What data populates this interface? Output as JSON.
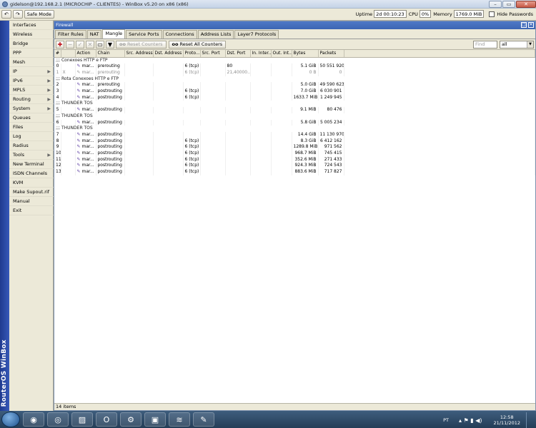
{
  "window": {
    "title": "gidelson@192.168.2.1 (MICROCHIP - CLIENTES) - WinBox v5.20 on x86 (x86)"
  },
  "toolbar": {
    "safe_mode": "Safe Mode",
    "uptime_label": "Uptime",
    "uptime": "2d 00:10:23",
    "cpu_label": "CPU",
    "cpu": "0%",
    "memory_label": "Memory",
    "memory": "1769.0 MiB",
    "hide_passwords": "Hide Passwords"
  },
  "sidebar": {
    "brand": "RouterOS WinBox",
    "items": [
      {
        "label": "Interfaces",
        "submenu": false
      },
      {
        "label": "Wireless",
        "submenu": false
      },
      {
        "label": "Bridge",
        "submenu": false
      },
      {
        "label": "PPP",
        "submenu": false
      },
      {
        "label": "Mesh",
        "submenu": false
      },
      {
        "label": "IP",
        "submenu": true
      },
      {
        "label": "IPv6",
        "submenu": true
      },
      {
        "label": "MPLS",
        "submenu": true
      },
      {
        "label": "Routing",
        "submenu": true
      },
      {
        "label": "System",
        "submenu": true
      },
      {
        "label": "Queues",
        "submenu": false
      },
      {
        "label": "Files",
        "submenu": false
      },
      {
        "label": "Log",
        "submenu": false
      },
      {
        "label": "Radius",
        "submenu": false
      },
      {
        "label": "Tools",
        "submenu": true
      },
      {
        "label": "New Terminal",
        "submenu": false
      },
      {
        "label": "ISDN Channels",
        "submenu": false
      },
      {
        "label": "KVM",
        "submenu": false
      },
      {
        "label": "Make Supout.rif",
        "submenu": false
      },
      {
        "label": "Manual",
        "submenu": false
      },
      {
        "label": "Exit",
        "submenu": false
      }
    ]
  },
  "firewall": {
    "title": "Firewall",
    "tabs": [
      "Filter Rules",
      "NAT",
      "Mangle",
      "Service Ports",
      "Connections",
      "Address Lists",
      "Layer7 Protocols"
    ],
    "active_tab": "Mangle",
    "reset_counters": "Reset Counters",
    "reset_all_counters": "Reset All Counters",
    "find_placeholder": "Find",
    "filter_value": "all",
    "columns": [
      "#",
      "",
      "Action",
      "Chain",
      "Src. Address",
      "Dst. Address",
      "Proto...",
      "Src. Port",
      "Dst. Port",
      "In. Inter...",
      "Out. Int...",
      "Bytes",
      "Packets"
    ],
    "rows": [
      {
        "type": "comment",
        "text": ";;; Conexoes HTTP e FTP"
      },
      {
        "type": "rule",
        "num": "0",
        "flag": "",
        "action": "mar...",
        "chain": "prerouting",
        "proto": "6 (tcp)",
        "dst_port": "80",
        "bytes": "5.1 GiB",
        "packets": "50 551 920"
      },
      {
        "type": "rule",
        "disabled": true,
        "num": "1",
        "flag": "X",
        "action": "mar...",
        "chain": "prerouting",
        "proto": "6 (tcp)",
        "dst_port": "21,40000...",
        "bytes": "0 B",
        "packets": "0"
      },
      {
        "type": "comment",
        "text": ";;; Rota Conexoes HTTP e FTP"
      },
      {
        "type": "rule",
        "num": "2",
        "flag": "",
        "action": "mar...",
        "chain": "prerouting",
        "proto": "",
        "dst_port": "",
        "bytes": "5.0 GiB",
        "packets": "49 590 623"
      },
      {
        "type": "rule",
        "num": "3",
        "flag": "",
        "action": "mar...",
        "chain": "postrouting",
        "proto": "6 (tcp)",
        "dst_port": "",
        "bytes": "7.0 GiB",
        "packets": "6 030 901"
      },
      {
        "type": "rule",
        "num": "4",
        "flag": "",
        "action": "mar...",
        "chain": "postrouting",
        "proto": "6 (tcp)",
        "dst_port": "",
        "bytes": "1633.7 MiB",
        "packets": "1 249 945"
      },
      {
        "type": "comment",
        "text": ";;; THUNDER TOS"
      },
      {
        "type": "rule",
        "num": "5",
        "flag": "",
        "action": "mar...",
        "chain": "postrouting",
        "proto": "",
        "dst_port": "",
        "bytes": "9.1 MiB",
        "packets": "80 476"
      },
      {
        "type": "comment",
        "text": ";;; THUNDER TOS"
      },
      {
        "type": "rule",
        "num": "6",
        "flag": "",
        "action": "mar...",
        "chain": "postrouting",
        "proto": "",
        "dst_port": "",
        "bytes": "5.8 GiB",
        "packets": "5 005 234"
      },
      {
        "type": "comment",
        "text": ";;; THUNDER TOS"
      },
      {
        "type": "rule",
        "num": "7",
        "flag": "",
        "action": "mar...",
        "chain": "postrouting",
        "proto": "",
        "dst_port": "",
        "bytes": "14.4 GiB",
        "packets": "11 130 970"
      },
      {
        "type": "rule",
        "num": "8",
        "flag": "",
        "action": "mar...",
        "chain": "postrouting",
        "proto": "6 (tcp)",
        "dst_port": "",
        "bytes": "8.3 GiB",
        "packets": "6 412 162"
      },
      {
        "type": "rule",
        "num": "9",
        "flag": "",
        "action": "mar...",
        "chain": "postrouting",
        "proto": "6 (tcp)",
        "dst_port": "",
        "bytes": "1289.8 MiB",
        "packets": "971 562"
      },
      {
        "type": "rule",
        "num": "10",
        "flag": "",
        "action": "mar...",
        "chain": "postrouting",
        "proto": "6 (tcp)",
        "dst_port": "",
        "bytes": "968.7 MiB",
        "packets": "745 415"
      },
      {
        "type": "rule",
        "num": "11",
        "flag": "",
        "action": "mar...",
        "chain": "postrouting",
        "proto": "6 (tcp)",
        "dst_port": "",
        "bytes": "352.6 MiB",
        "packets": "271 433"
      },
      {
        "type": "rule",
        "num": "12",
        "flag": "",
        "action": "mar...",
        "chain": "postrouting",
        "proto": "6 (tcp)",
        "dst_port": "",
        "bytes": "924.3 MiB",
        "packets": "724 543"
      },
      {
        "type": "rule",
        "num": "13",
        "flag": "",
        "action": "mar...",
        "chain": "postrouting",
        "proto": "6 (tcp)",
        "dst_port": "",
        "bytes": "883.6 MiB",
        "packets": "717 827"
      }
    ],
    "status": "14 items"
  },
  "taskbar": {
    "apps": [
      {
        "icon": "chrome-icon",
        "glyph": "◉"
      },
      {
        "icon": "circle-app-icon",
        "glyph": "◎"
      },
      {
        "icon": "paint-icon",
        "glyph": "▨"
      },
      {
        "icon": "opera-icon",
        "glyph": "O"
      },
      {
        "icon": "network-icon",
        "glyph": "⚙"
      },
      {
        "icon": "remote-desktop-icon",
        "glyph": "▣"
      },
      {
        "icon": "winbox-icon",
        "glyph": "≋"
      },
      {
        "icon": "tool-icon",
        "glyph": "✎"
      }
    ],
    "language": "PT",
    "time": "12:58",
    "date": "21/11/2012"
  }
}
